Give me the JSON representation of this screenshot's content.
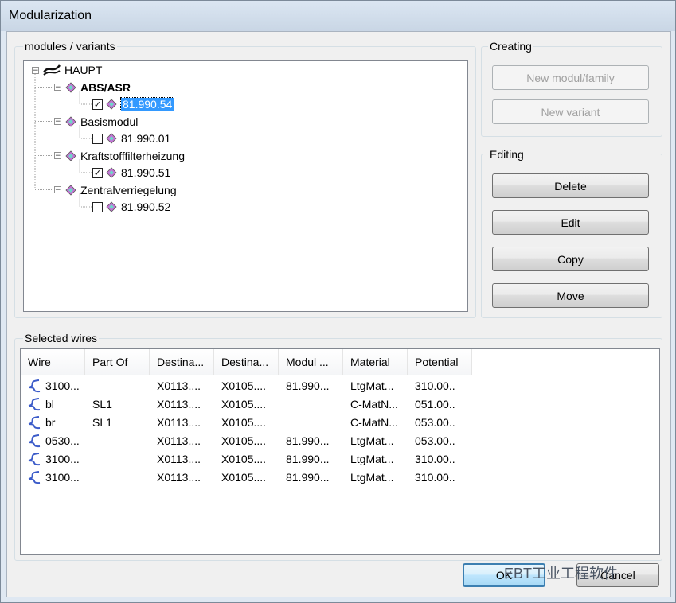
{
  "window": {
    "title": "Modularization"
  },
  "modules_group": {
    "label": "modules / variants"
  },
  "tree": {
    "root": "HAUPT",
    "modules": [
      {
        "name": "ABS/ASR",
        "bold": true,
        "variant": "81.990.54",
        "checked": true,
        "selected": true
      },
      {
        "name": "Basismodul",
        "bold": false,
        "variant": "81.990.01",
        "checked": false,
        "selected": false
      },
      {
        "name": "Kraftstofffilterheizung",
        "bold": false,
        "variant": "81.990.51",
        "checked": true,
        "selected": false
      },
      {
        "name": "Zentralverriegelung",
        "bold": false,
        "variant": "81.990.52",
        "checked": false,
        "selected": false
      }
    ],
    "expander_symbol": "−",
    "check_symbol": "✓"
  },
  "creating": {
    "label": "Creating",
    "new_family": "New modul/family",
    "new_variant": "New variant"
  },
  "editing": {
    "label": "Editing",
    "delete": "Delete",
    "edit": "Edit",
    "copy": "Copy",
    "move": "Move"
  },
  "wires_group": {
    "label": "Selected wires"
  },
  "wires_table": {
    "columns": [
      "Wire",
      "Part Of",
      "Destina...",
      "Destina...",
      "Modul ...",
      "Material",
      "Potential"
    ],
    "rows": [
      [
        "3100...",
        "",
        "X0113....",
        "X0105....",
        "81.990...",
        "LtgMat...",
        "310.00.."
      ],
      [
        "bl",
        "SL1",
        "X0113....",
        "X0105....",
        "",
        "C-MatN...",
        "051.00.."
      ],
      [
        "br",
        "SL1",
        "X0113....",
        "X0105....",
        "",
        "C-MatN...",
        "053.00.."
      ],
      [
        "0530...",
        "",
        "X0113....",
        "X0105....",
        "81.990...",
        "LtgMat...",
        "053.00.."
      ],
      [
        "3100...",
        "",
        "X0113....",
        "X0105....",
        "81.990...",
        "LtgMat...",
        "310.00.."
      ],
      [
        "3100...",
        "",
        "X0113....",
        "X0105....",
        "81.990...",
        "LtgMat...",
        "310.00.."
      ]
    ]
  },
  "footer": {
    "ok": "OK",
    "cancel": "Cancel",
    "watermark": "EBT工业工程软件"
  },
  "colors": {
    "selection": "#3399ff",
    "wire_icon": "#3b5bc9"
  },
  "icons": {
    "root": "harness-icon",
    "module": "module-icon",
    "variant": "variant-icon",
    "wire": "wire-icon"
  }
}
